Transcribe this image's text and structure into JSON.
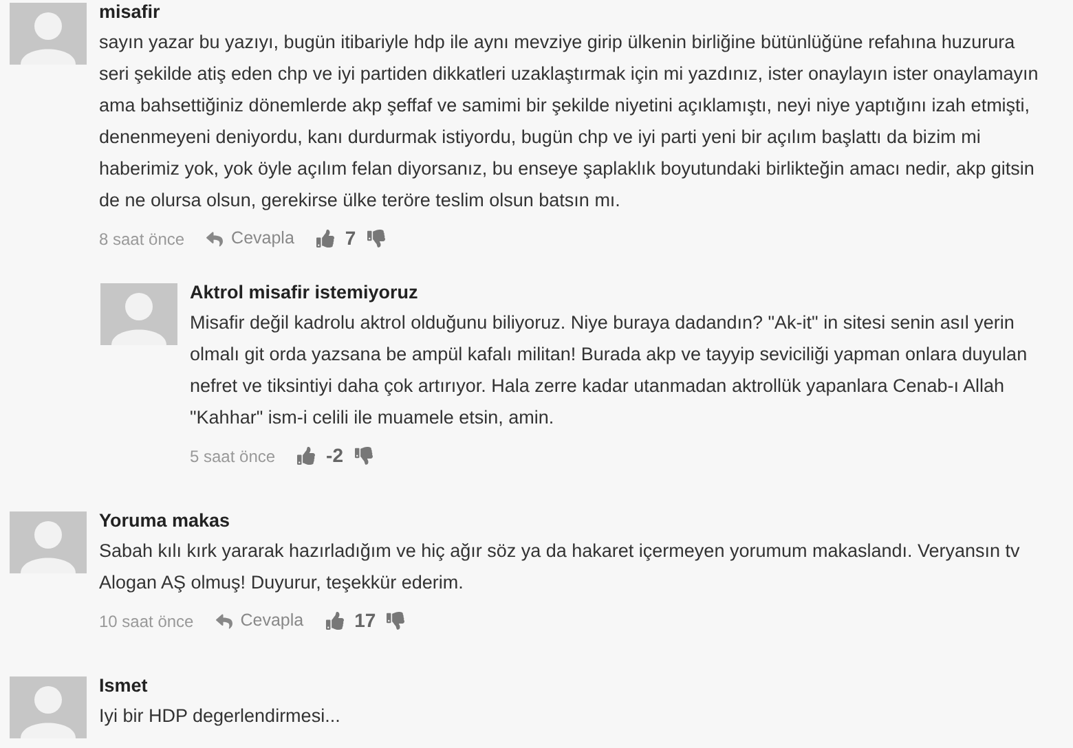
{
  "comments": [
    {
      "author": "misafir",
      "text": "sayın yazar bu yazıyı, bugün itibariyle hdp ile aynı mevziye girip ülkenin birliğine bütünlüğüne refahına huzurura seri şekilde atiş eden chp ve iyi partiden dikkatleri uzaklaştırmak için mi yazdınız, ister onaylayın ister onaylamayın ama bahsettiğiniz dönemlerde akp şeffaf ve samimi bir şekilde niyetini açıklamıştı, neyi niye yaptığını izah etmişti, denenmeyeni deniyordu, kanı durdurmak istiyordu, bugün chp ve iyi parti yeni bir açılım başlattı da bizim mi haberimiz yok, yok öyle açılım felan diyorsanız, bu enseye şaplaklık boyutundaki birlikteğin amacı nedir, akp gitsin de ne olursa olsun, gerekirse ülke teröre teslim olsun batsın mı.",
      "time": "8 saat önce",
      "reply": "Cevapla",
      "votes": "7",
      "children": [
        {
          "author": "Aktrol misafir istemiyoruz",
          "text": "Misafir değil kadrolu aktrol olduğunu biliyoruz. Niye buraya dadandın? \"Ak-it\" in sitesi senin asıl yerin olmalı git orda yazsana be ampül kafalı militan! Burada akp ve tayyip seviciliği yapman onlara duyulan nefret ve tiksintiyi daha çok artırıyor. Hala zerre kadar utanmadan aktrollük yapanlara Cenab-ı Allah \"Kahhar\" ism-i celili ile muamele etsin, amin.",
          "time": "5 saat önce",
          "votes": "-2"
        }
      ]
    },
    {
      "author": "Yoruma makas",
      "text": "Sabah kılı kırk yararak hazırladığım ve hiç ağır söz ya da hakaret içermeyen yorumum makaslandı. Veryansın tv Alogan AŞ olmuş! Duyurur, teşekkür ederim.",
      "time": "10 saat önce",
      "reply": "Cevapla",
      "votes": "17"
    },
    {
      "author": "Ismet",
      "text": "Iyi bir HDP degerlendirmesi..."
    }
  ]
}
